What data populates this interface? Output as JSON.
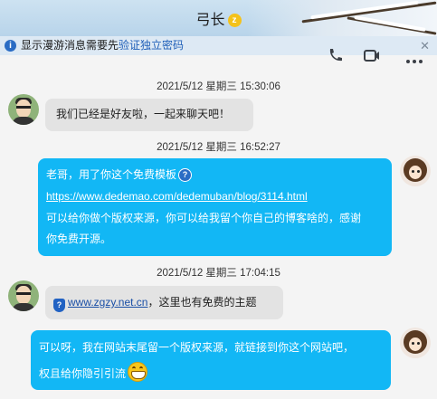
{
  "header": {
    "contact_name": "弓长",
    "vip_badge": "z"
  },
  "notice": {
    "text": "显示漫游消息需要先",
    "link": "验证独立密码",
    "info_icon": "info-icon",
    "close_icon": "close-icon"
  },
  "toolbar": {
    "icons": [
      "phone-icon",
      "video-icon",
      "more-icon"
    ]
  },
  "messages": [
    {
      "time": "2021/5/12 星期三 15:30:06",
      "sender": "other",
      "lines": [
        "我们已经是好友啦，一起来聊天吧！"
      ]
    },
    {
      "time": "2021/5/12 星期三 16:52:27",
      "sender": "me",
      "line1": "老哥，用了你这个免费模板",
      "link": "https://www.dedemao.com/dedemuban/blog/3114.html",
      "line3": "可以给你做个版权来源，你可以给我留个你自己的博客啥的，感谢",
      "line4": "你免费开源。"
    },
    {
      "time": "2021/5/12 星期三 17:04:15",
      "sender": "other",
      "link": "www.zgzy.net.cn",
      "text": "，这里也有免费的主题"
    },
    {
      "sender": "me",
      "line1": "可以呀，我在网站末尾留一个版权来源，就链接到你这个网站吧，",
      "line2": "权且给你隐引引流"
    }
  ]
}
